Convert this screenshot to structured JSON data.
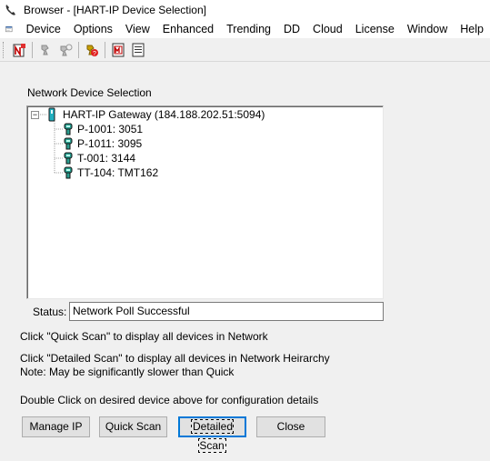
{
  "window": {
    "title": "Browser - [HART-IP Device Selection]"
  },
  "menu": [
    "Device",
    "Options",
    "View",
    "Enhanced",
    "Trending",
    "DD",
    "Cloud",
    "License",
    "Window",
    "Help"
  ],
  "toolbar": {
    "icons": [
      "new-device-icon",
      "disconnect-icon",
      "poll-icon",
      "device-help-icon",
      "pdf-report-icon",
      "text-report-icon"
    ]
  },
  "network": {
    "label": "Network Device Selection",
    "gateway": "HART-IP Gateway (184.188.202.51:5094)",
    "expander": "−",
    "devices": [
      "P-1001: 3051",
      "P-1011: 3095",
      "T-001: 3144",
      "TT-104: TMT162"
    ]
  },
  "status": {
    "label": "Status:",
    "value": "Network Poll Successful"
  },
  "info": {
    "quick": "Click \"Quick Scan\" to display all devices in Network",
    "detailed": "Click \"Detailed Scan\" to display all devices in Network Heirarchy",
    "note": "Note: May be significantly slower than Quick",
    "double_click": "Double Click on desired device above for configuration details"
  },
  "buttons": {
    "manage_ip": "Manage IP",
    "quick_scan": "Quick Scan",
    "detailed_scan": "Detailed Scan",
    "close": "Close"
  },
  "colors": {
    "window_bg": "#f0f0f0",
    "device_icon": "#2a9d8f",
    "focus": "#0078d7"
  }
}
